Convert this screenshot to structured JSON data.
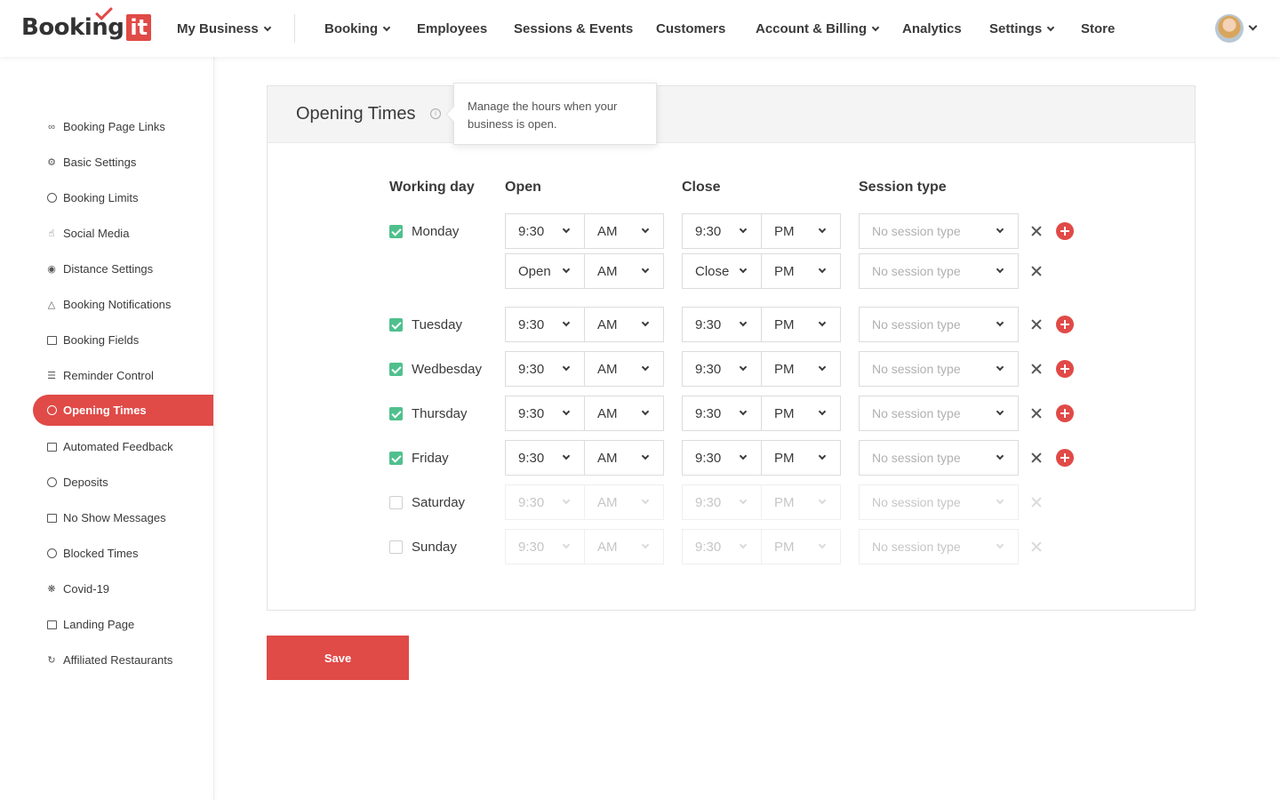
{
  "brand": {
    "word": "Booking",
    "suffix": "it"
  },
  "nav": {
    "my_business": "My Business",
    "booking": "Booking",
    "employees": "Employees",
    "sessions_events": "Sessions & Events",
    "customers": "Customers",
    "account_billing": "Account & Billing",
    "analytics": "Analytics",
    "settings": "Settings",
    "store": "Store"
  },
  "sidebar": {
    "items": [
      {
        "label": "Booking Page Links",
        "icon": "link-icon"
      },
      {
        "label": "Basic Settings",
        "icon": "gear-icon"
      },
      {
        "label": "Booking Limits",
        "icon": "alarm-icon"
      },
      {
        "label": "Social Media",
        "icon": "thumbs-up-icon"
      },
      {
        "label": "Distance Settings",
        "icon": "location-pin-icon"
      },
      {
        "label": "Booking Notifications",
        "icon": "bell-icon"
      },
      {
        "label": "Booking Fields",
        "icon": "fields-icon"
      },
      {
        "label": "Reminder Control",
        "icon": "sliders-icon"
      },
      {
        "label": "Opening Times",
        "icon": "clock-icon",
        "active": true
      },
      {
        "label": "Automated Feedback",
        "icon": "feedback-icon"
      },
      {
        "label": "Deposits",
        "icon": "deposit-icon"
      },
      {
        "label": "No Show Messages",
        "icon": "message-icon"
      },
      {
        "label": "Blocked Times",
        "icon": "clock-icon"
      },
      {
        "label": "Covid-19",
        "icon": "virus-icon"
      },
      {
        "label": "Landing Page",
        "icon": "monitor-icon"
      },
      {
        "label": "Affiliated Restaurants",
        "icon": "refresh-icon"
      }
    ]
  },
  "card": {
    "title": "Opening Times",
    "tooltip": "Manage the hours when your business is open."
  },
  "columns": {
    "working_day": "Working day",
    "open": "Open",
    "close": "Close",
    "session_type": "Session type"
  },
  "rows": {
    "monday": {
      "day": "Monday",
      "checked": true,
      "open": "9:30",
      "open_ampm": "AM",
      "close": "9:30",
      "close_ampm": "PM",
      "session": "No session type"
    },
    "monday_extra": {
      "open": "Open",
      "open_ampm": "AM",
      "close": "Close",
      "close_ampm": "PM",
      "session": "No session type"
    },
    "tuesday": {
      "day": "Tuesday",
      "checked": true,
      "open": "9:30",
      "open_ampm": "AM",
      "close": "9:30",
      "close_ampm": "PM",
      "session": "No session type"
    },
    "wednesday": {
      "day": "Wedbesday",
      "checked": true,
      "open": "9:30",
      "open_ampm": "AM",
      "close": "9:30",
      "close_ampm": "PM",
      "session": "No session type"
    },
    "thursday": {
      "day": "Thursday",
      "checked": true,
      "open": "9:30",
      "open_ampm": "AM",
      "close": "9:30",
      "close_ampm": "PM",
      "session": "No session type"
    },
    "friday": {
      "day": "Friday",
      "checked": true,
      "open": "9:30",
      "open_ampm": "AM",
      "close": "9:30",
      "close_ampm": "PM",
      "session": "No session type"
    },
    "saturday": {
      "day": "Saturday",
      "checked": false,
      "open": "9:30",
      "open_ampm": "AM",
      "close": "9:30",
      "close_ampm": "PM",
      "session": "No session type"
    },
    "sunday": {
      "day": "Sunday",
      "checked": false,
      "open": "9:30",
      "open_ampm": "AM",
      "close": "9:30",
      "close_ampm": "PM",
      "session": "No session type"
    }
  },
  "actions": {
    "save": "Save"
  },
  "colors": {
    "accent": "#e04a47",
    "check": "#4fc08d"
  }
}
